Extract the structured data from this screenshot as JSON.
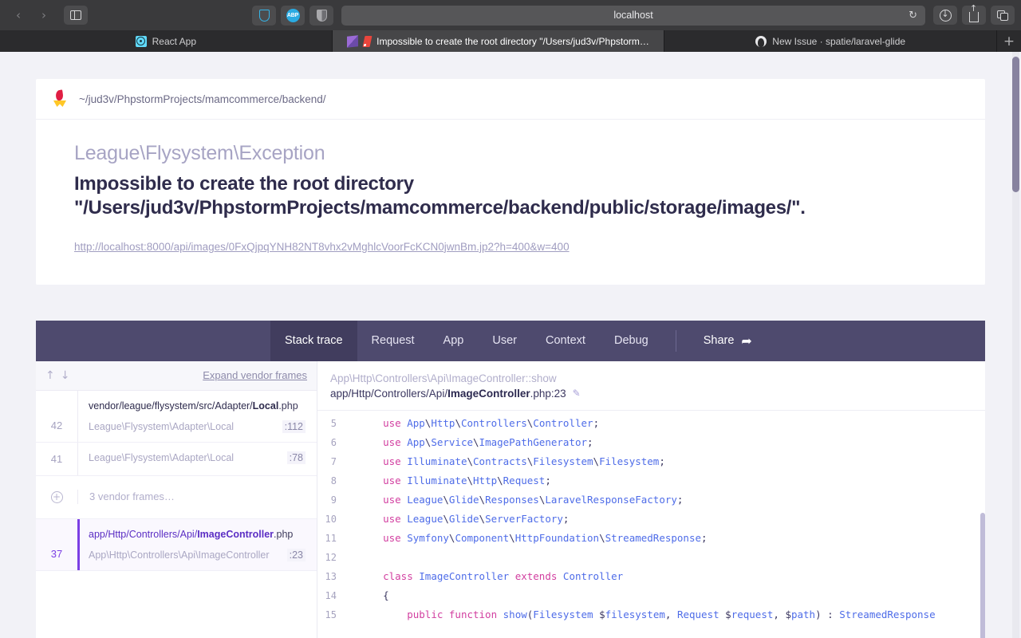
{
  "browser": {
    "url": "localhost",
    "nav": {
      "back": "‹",
      "forward": "›",
      "sidebar_icon": "sidebar-icon"
    },
    "extensions": [
      {
        "name": "shield-extension-icon",
        "label": ""
      },
      {
        "name": "adblock-plus-icon",
        "label": "ABP"
      },
      {
        "name": "privacy-shield-icon",
        "label": ""
      }
    ],
    "reload_icon": "↻",
    "right_buttons": [
      {
        "name": "downloads-button"
      },
      {
        "name": "share-button"
      },
      {
        "name": "tab-overview-button"
      }
    ],
    "tabs": [
      {
        "title": "React App",
        "favicon": "react-icon",
        "active": false
      },
      {
        "title": "Impossible to create the root directory \"/Users/jud3v/Phpstorm…",
        "favicon": "ignition-icon",
        "active": true
      },
      {
        "title": "New Issue · spatie/laravel-glide",
        "favicon": "github-icon",
        "active": false
      }
    ],
    "new_tab_label": "+"
  },
  "exception": {
    "project_path": "~/jud3v/PhpstormProjects/mamcommerce/backend/",
    "class": "League\\Flysystem\\Exception",
    "message": "Impossible to create the root directory \"/Users/jud3v/PhpstormProjects/mamcommerce/backend/public/storage/images/\".",
    "request_url": "http://localhost:8000/api/images/0FxQjpqYNH82NT8vhx2vMghlcVoorFcKCN0jwnBm.jp2?h=400&w=400"
  },
  "nav": {
    "tabs": [
      {
        "label": "Stack trace",
        "active": true
      },
      {
        "label": "Request",
        "active": false
      },
      {
        "label": "App",
        "active": false
      },
      {
        "label": "User",
        "active": false
      },
      {
        "label": "Context",
        "active": false
      },
      {
        "label": "Debug",
        "active": false
      }
    ],
    "share_label": "Share",
    "share_icon": "➦"
  },
  "frames_panel": {
    "up_arrow": "↑",
    "down_arrow": "↓",
    "expand_label": "Expand vendor frames",
    "frames": [
      {
        "number": "42",
        "file_dir": "vendor/league/flysystem/src/Adapter/",
        "file_name": "Local",
        "file_ext": ".php",
        "class": "League\\Flysystem\\Adapter\\Local",
        "line": ":112",
        "selected": false,
        "show_file": true
      },
      {
        "number": "41",
        "file_dir": "",
        "file_name": "",
        "file_ext": "",
        "class": "League\\Flysystem\\Adapter\\Local",
        "line": ":78",
        "selected": false,
        "show_file": false
      },
      {
        "number": "",
        "collapsed_label": "3 vendor frames…",
        "collapsed": true,
        "plus_icon": "+"
      },
      {
        "number": "37",
        "file_dir": "app/Http/Controllers/Api/",
        "file_name": "ImageController",
        "file_ext": ".php",
        "class": "App\\Http\\Controllers\\Api\\ImageController",
        "line": ":23",
        "selected": true,
        "show_file": true
      }
    ]
  },
  "code_panel": {
    "signature": "App\\Http\\Controllers\\Api\\ImageController::show",
    "file_prefix": "app/Http/Controllers/Api/",
    "file_bold": "ImageController",
    "file_suffix": ".php:23",
    "edit_icon": "✎",
    "lines": [
      {
        "num": "5",
        "code": "    use App\\Http\\Controllers\\Controller;"
      },
      {
        "num": "6",
        "code": "    use App\\Service\\ImagePathGenerator;"
      },
      {
        "num": "7",
        "code": "    use Illuminate\\Contracts\\Filesystem\\Filesystem;"
      },
      {
        "num": "8",
        "code": "    use Illuminate\\Http\\Request;"
      },
      {
        "num": "9",
        "code": "    use League\\Glide\\Responses\\LaravelResponseFactory;"
      },
      {
        "num": "10",
        "code": "    use League\\Glide\\ServerFactory;"
      },
      {
        "num": "11",
        "code": "    use Symfony\\Component\\HttpFoundation\\StreamedResponse;"
      },
      {
        "num": "12",
        "code": ""
      },
      {
        "num": "13",
        "code": "    class ImageController extends Controller"
      },
      {
        "num": "14",
        "code": "    {"
      },
      {
        "num": "15",
        "code": "        public function show(Filesystem $filesystem, Request $request, $path) : StreamedResponse"
      }
    ]
  },
  "colors": {
    "accent_purple": "#7b3fe4",
    "nav_bg": "#4e4a6e",
    "nav_active": "#413d5e",
    "keyword": "#d23fa0",
    "namespace": "#4e6ce8"
  }
}
